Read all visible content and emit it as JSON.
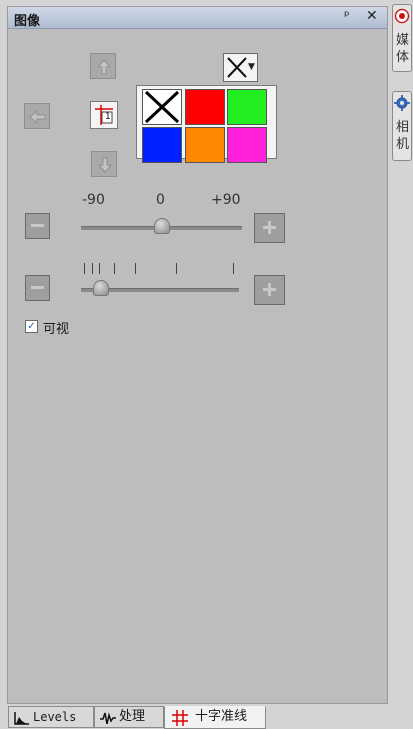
{
  "panel": {
    "title": "图像",
    "pin_glyph": "ᵖ",
    "close_glyph": "✕"
  },
  "crosshair": {
    "style_badge": "1",
    "selected_style": "X"
  },
  "palette": {
    "swatches": [
      {
        "color": "#ffffff",
        "mark": "X"
      },
      {
        "color": "#ff0000"
      },
      {
        "color": "#22ee22"
      },
      {
        "color": "#0022ff"
      },
      {
        "color": "#ff8800"
      },
      {
        "color": "#ff22dd"
      }
    ]
  },
  "rotation_slider": {
    "ticks": [
      "-90",
      "0",
      "+90"
    ],
    "min": -90,
    "max": 90,
    "value": 0
  },
  "size_slider": {
    "value_fraction": 0.08
  },
  "visible_checkbox": {
    "label": "可视",
    "checked": true,
    "mark": "✓"
  },
  "bottom_tabs": [
    {
      "label": "Levels",
      "icon": "levels-icon"
    },
    {
      "label": "处理",
      "icon": "waveform-icon"
    },
    {
      "label": "十字准线",
      "icon": "crosshair-icon",
      "active": true
    }
  ],
  "side_tabs": [
    {
      "chars": [
        "媒",
        "体"
      ],
      "icon": "media-record-icon"
    },
    {
      "chars": [
        "相",
        "机"
      ],
      "icon": "camera-gear-icon"
    }
  ]
}
